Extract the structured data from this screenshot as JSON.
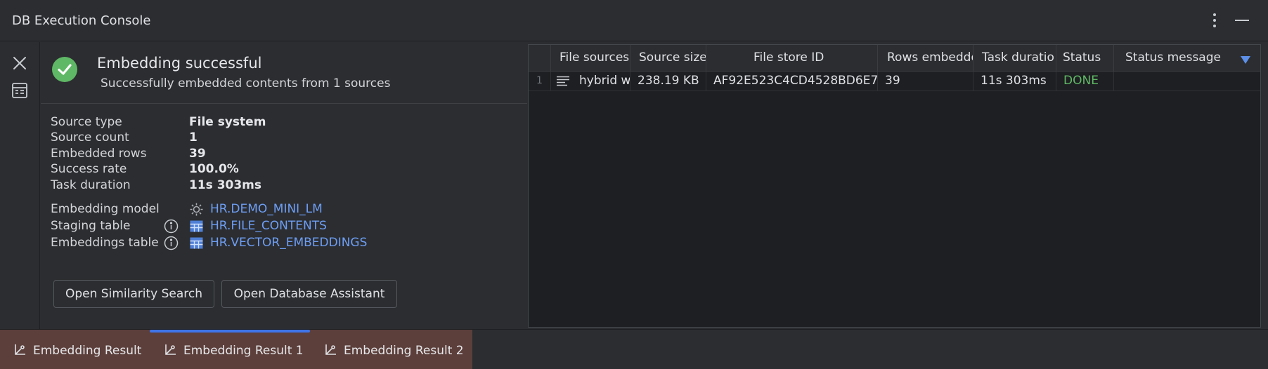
{
  "window": {
    "title": "DB Execution Console",
    "more_icon": "more-vertical-icon",
    "minimize_icon": "minimize-icon"
  },
  "left_strip": {
    "close_icon": "close-icon",
    "layout_icon": "layout-icon"
  },
  "result": {
    "status_icon": "check-circle-icon",
    "title": "Embedding successful",
    "subtitle": "Successfully embedded contents from 1 sources",
    "details": [
      {
        "label": "Source type",
        "value": "File system"
      },
      {
        "label": "Source count",
        "value": "1"
      },
      {
        "label": "Embedded rows",
        "value": "39"
      },
      {
        "label": "Success rate",
        "value": "100.0%"
      },
      {
        "label": "Task duration",
        "value": "11s 303ms"
      }
    ],
    "objects": [
      {
        "label": "Embedding model",
        "icon": "model-icon",
        "value": "HR.DEMO_MINI_LM"
      },
      {
        "label": "Staging table",
        "icon": "table-icon",
        "value": "HR.FILE_CONTENTS"
      },
      {
        "label": "Embeddings table",
        "icon": "table-icon",
        "value": "HR.VECTOR_EMBEDDINGS"
      }
    ],
    "buttons": {
      "similarity": "Open Similarity Search",
      "assistant": "Open Database Assistant"
    }
  },
  "table": {
    "columns": [
      "File sources",
      "Source size",
      "File store ID",
      "Rows embedde",
      "Task duratio",
      "Status",
      "Status message"
    ],
    "rows": [
      {
        "num": "1",
        "file": "hybrid worl",
        "size": "238.19 KB",
        "store_id": "AF92E523C4CD4528BD6E7",
        "rows": "39",
        "duration": "11s 303ms",
        "status": "DONE",
        "message": ""
      }
    ]
  },
  "tabs": [
    {
      "label": "Embedding Result"
    },
    {
      "label": "Embedding Result 1"
    },
    {
      "label": "Embedding Result 2"
    }
  ],
  "colors": {
    "accent": "#3e74e8",
    "success": "#5fb865",
    "link": "#6e9ef5",
    "tab_group_bg": "#5c3f3b"
  }
}
